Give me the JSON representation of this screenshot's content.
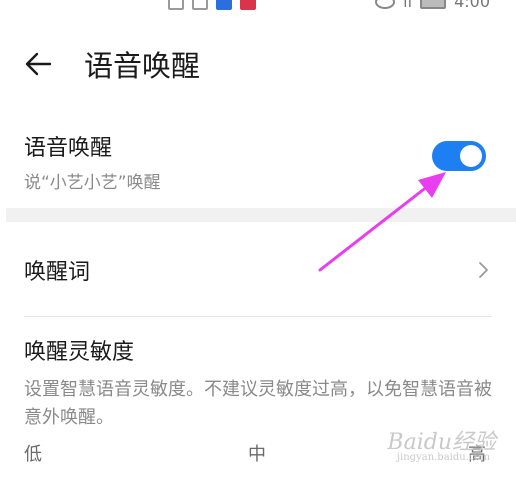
{
  "status_bar": {
    "time": "4:00"
  },
  "header": {
    "title": "语音唤醒"
  },
  "voice_wake": {
    "title": "语音唤醒",
    "subtitle": "说“小艺小艺”唤醒",
    "enabled": true,
    "accent_color": "#1e7ff2"
  },
  "wake_word": {
    "title": "唤醒词"
  },
  "sensitivity": {
    "title": "唤醒灵敏度",
    "description": "设置智慧语音灵敏度。不建议灵敏度过高，以免智慧语音被意外唤醒。",
    "labels": {
      "low": "低",
      "mid": "中",
      "high": "高"
    }
  },
  "annotation": {
    "arrow_color": "#e83ef0"
  },
  "watermark": {
    "main": "Baidu经验",
    "sub": "jingyan.baidu.com"
  }
}
